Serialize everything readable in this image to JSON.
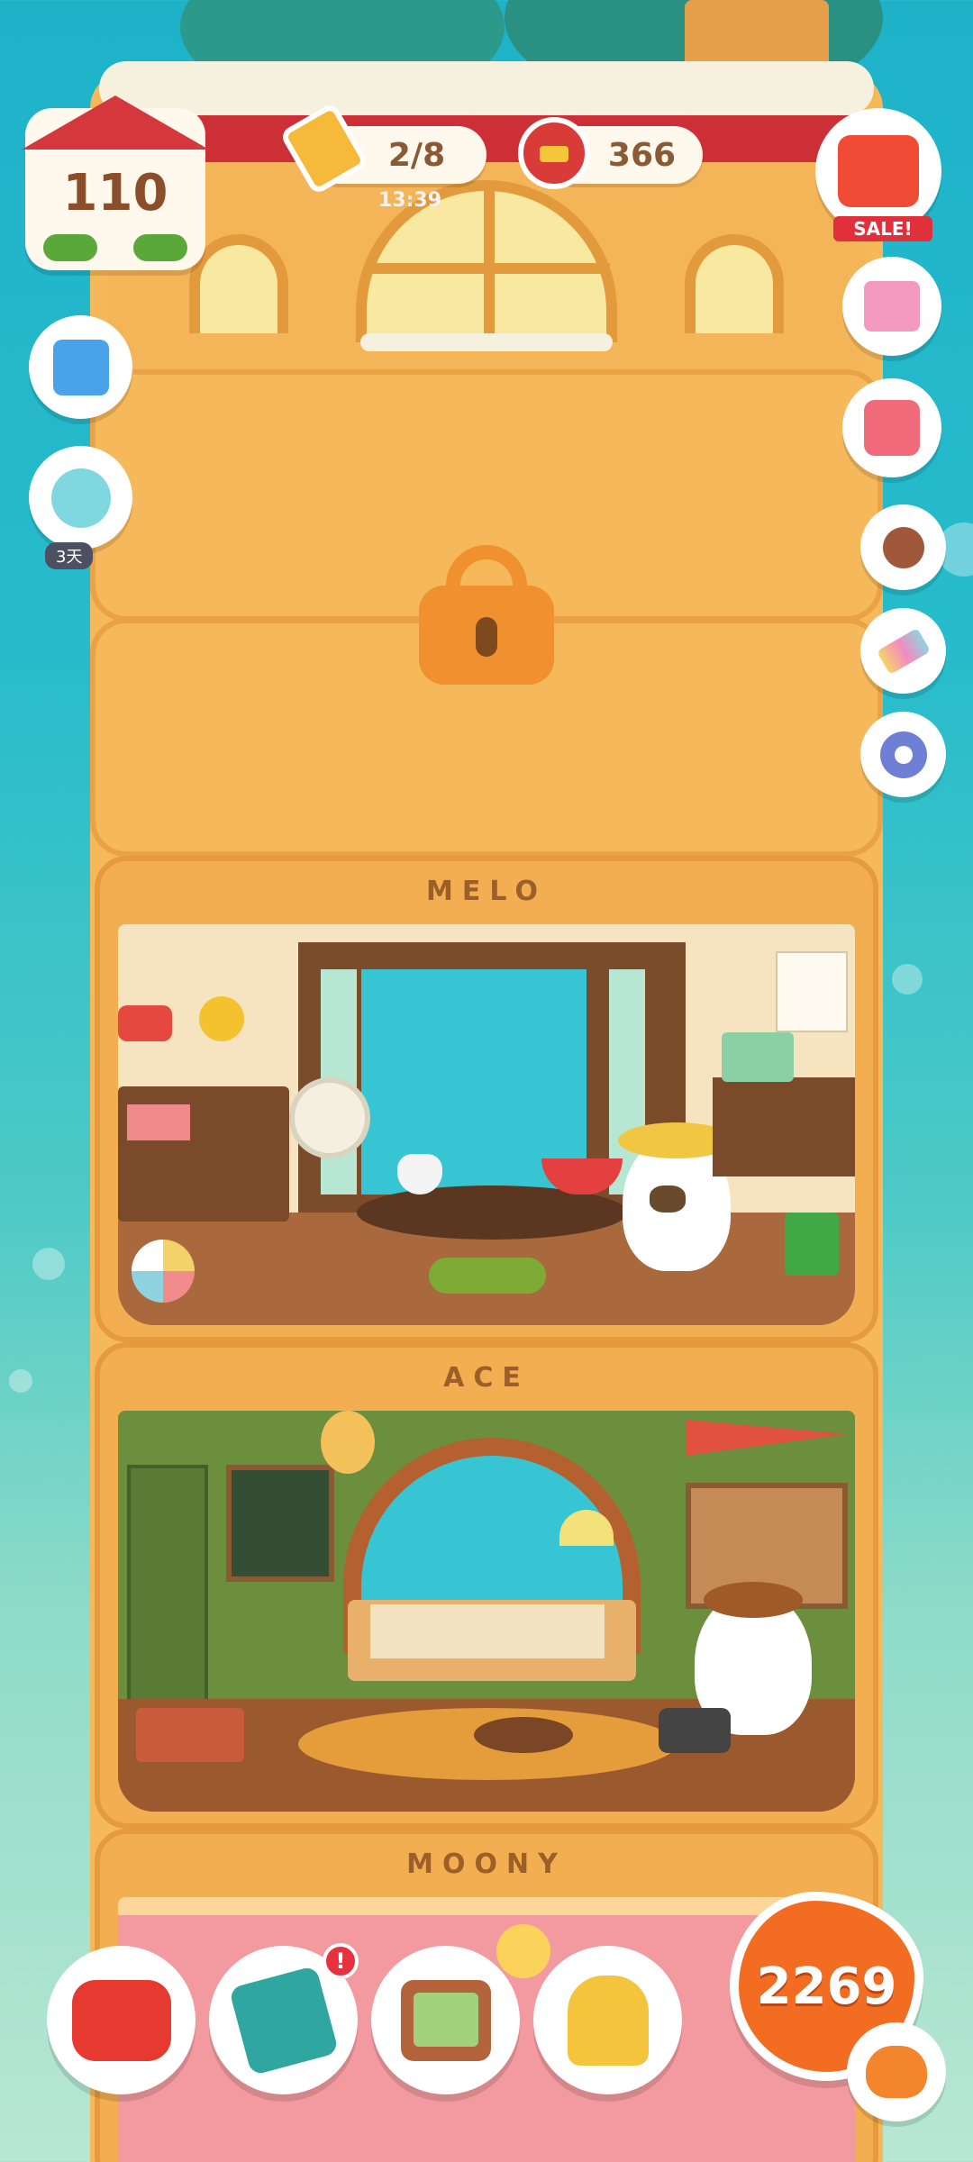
{
  "hud": {
    "house_level": "110",
    "pencil_count": "2/8",
    "pencil_timer": "13:39",
    "cans_count": "366",
    "sale_label": "SALE!",
    "event_days": "3天"
  },
  "rooms": [
    {
      "name": "MELO"
    },
    {
      "name": "ACE"
    },
    {
      "name": "MOONY"
    }
  ],
  "bottom_bar": {
    "coins": "2269",
    "alert": "!"
  },
  "icons": {
    "side_left": [
      "gift-icon",
      "snow-globe-icon"
    ],
    "side_right": [
      "shop-icon",
      "present-box-icon",
      "heart-safe-icon",
      "stamp-icon",
      "paint-brush-icon",
      "settings-gear-icon"
    ],
    "bottom": [
      "furniture-armchair-icon",
      "paw-journal-icon",
      "photo-frame-icon",
      "trophy-lamp-icon",
      "cat-face-icon"
    ]
  },
  "colors": {
    "sky": "#1eb2c9",
    "building": "#f5b85a",
    "roof": "#cc2f35",
    "coin": "#f26d22"
  }
}
